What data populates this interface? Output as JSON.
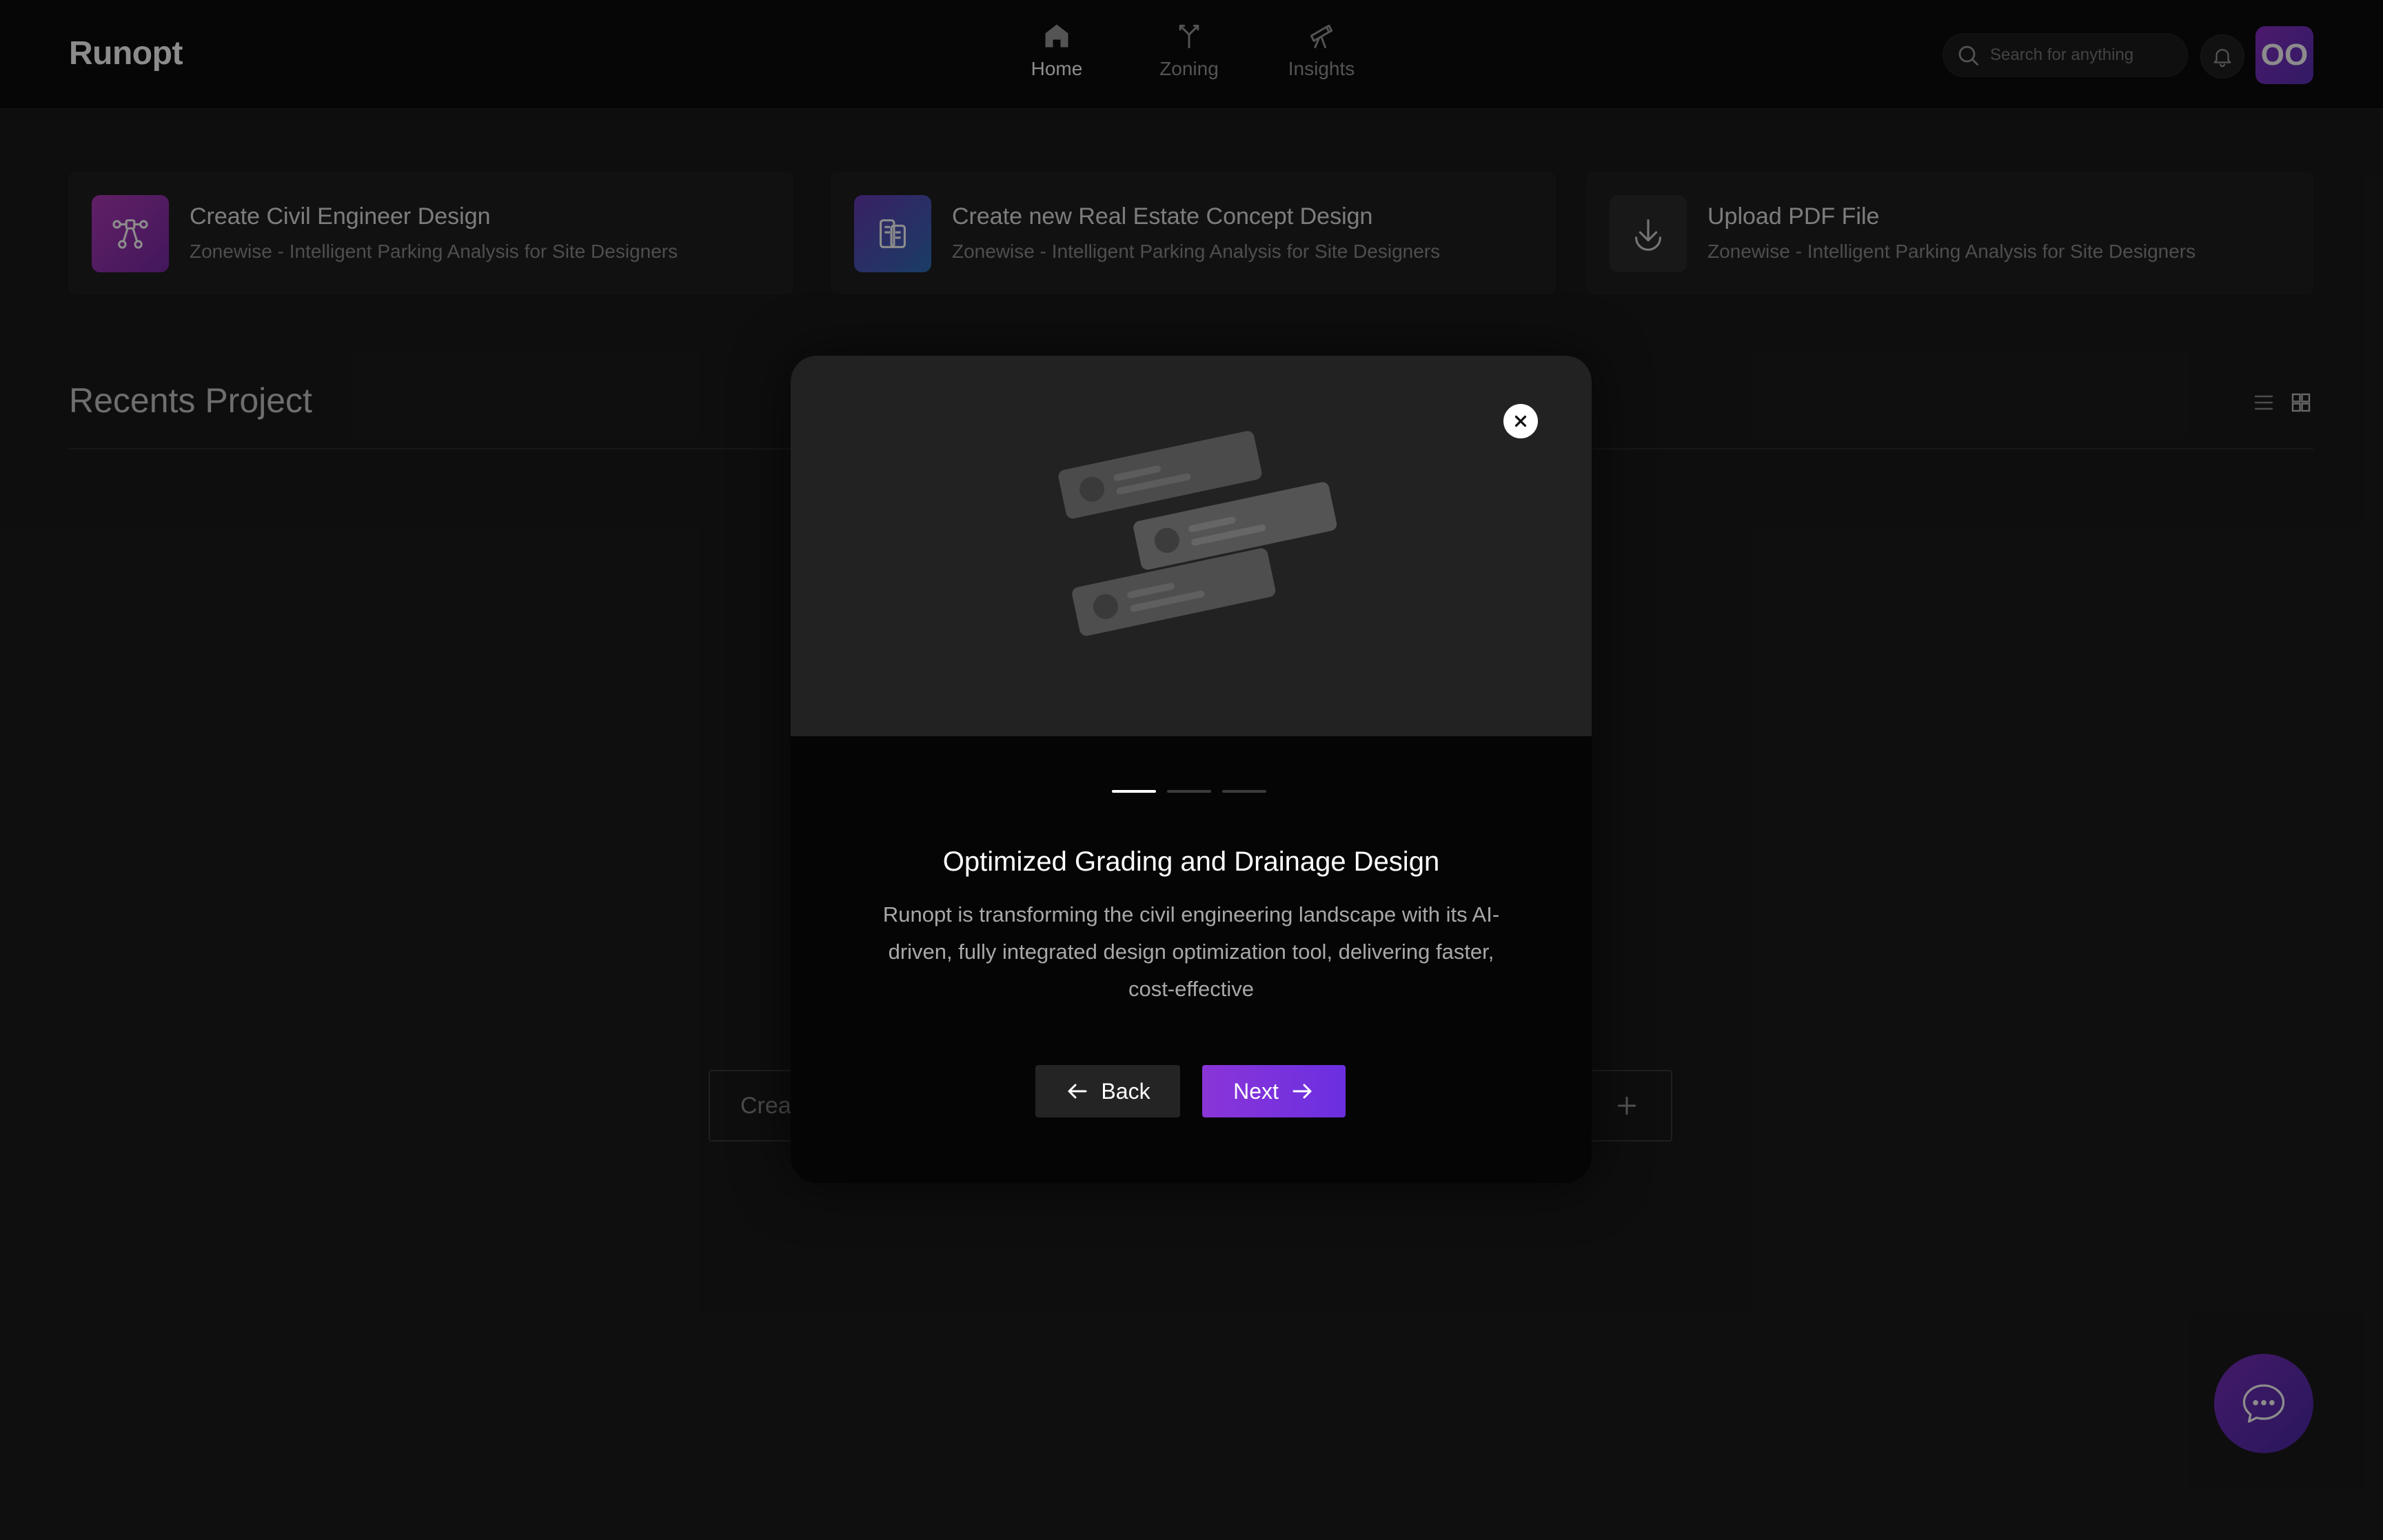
{
  "header": {
    "logo": "Runopt",
    "nav": [
      {
        "label": "Home",
        "icon": "home-icon",
        "active": true
      },
      {
        "label": "Zoning",
        "icon": "zoning-icon",
        "active": false
      },
      {
        "label": "Insights",
        "icon": "telescope-icon",
        "active": false
      }
    ],
    "search_placeholder": "Search for anything",
    "avatar_initials": "OO"
  },
  "cards": [
    {
      "title": "Create Civil Engineer Design",
      "subtitle": "Zonewise - Intelligent Parking Analysis for Site Designers",
      "icon": "network-icon"
    },
    {
      "title": "Create new Real Estate Concept Design",
      "subtitle": "Zonewise - Intelligent Parking Analysis for Site Designers",
      "icon": "building-icon"
    },
    {
      "title": "Upload PDF File",
      "subtitle": "Zonewise - Intelligent Parking Analysis for Site Designers",
      "icon": "download-icon"
    }
  ],
  "recents": {
    "title": "Recents Project",
    "create_button_text": "Crea"
  },
  "modal": {
    "title": "Optimized Grading and Drainage Design",
    "description": "Runopt is transforming the civil engineering landscape with its AI-driven, fully integrated design optimization tool, delivering faster, cost-effective",
    "back_label": "Back",
    "next_label": "Next",
    "step": 1,
    "total_steps": 3
  },
  "colors": {
    "accent_gradient_start": "#8a35d8",
    "accent_gradient_end": "#6b2fe0"
  }
}
